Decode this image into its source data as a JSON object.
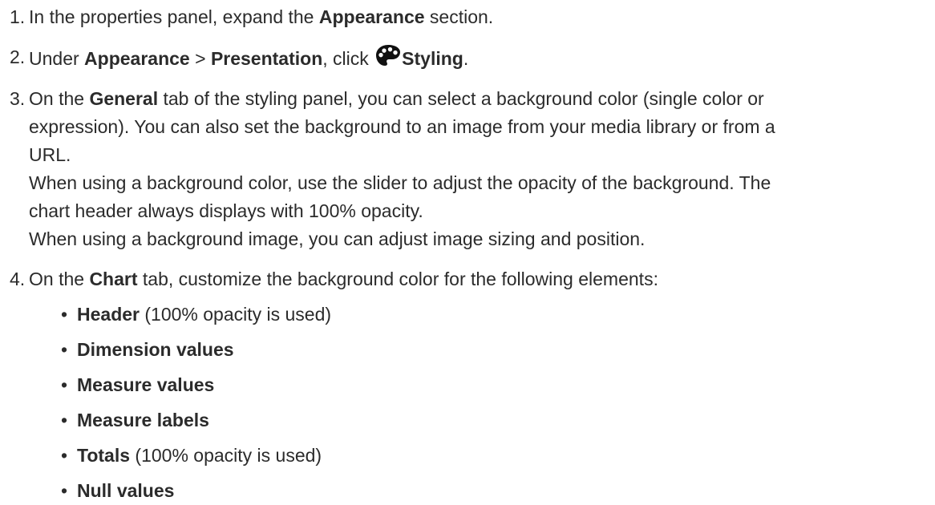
{
  "steps": [
    {
      "number": "1.",
      "pre": "In the properties panel, expand the ",
      "bold": "Appearance",
      "post": " section."
    },
    {
      "number": "2.",
      "pre": "Under ",
      "bold1": "Appearance",
      "mid1": " > ",
      "bold2": "Presentation",
      "mid2": ", click ",
      "icon": "palette-icon",
      "bold3": "Styling",
      "post": "."
    },
    {
      "number": "3.",
      "pre": "On the ",
      "bold": "General",
      "line1_post": " tab of the styling panel, you can select a background color (single color or",
      "line2": "expression). You can also set the background to an image from your media library or from a",
      "line3": "URL.",
      "line4": "When using a background color, use the slider to adjust the opacity of the background. The",
      "line5": "chart header always displays with 100% opacity.",
      "line6": "When using a background image, you can adjust image sizing and position."
    },
    {
      "number": "4.",
      "pre": "On the ",
      "bold": "Chart",
      "post": " tab, customize the background color for the following elements:",
      "bullets": [
        {
          "bold": "Header",
          "note": " (100% opacity is used)"
        },
        {
          "bold": "Dimension values",
          "note": ""
        },
        {
          "bold": "Measure values",
          "note": ""
        },
        {
          "bold": "Measure labels",
          "note": ""
        },
        {
          "bold": "Totals",
          "note": " (100% opacity is used)"
        },
        {
          "bold": "Null values",
          "note": ""
        }
      ]
    }
  ],
  "bullet_glyph": "•"
}
